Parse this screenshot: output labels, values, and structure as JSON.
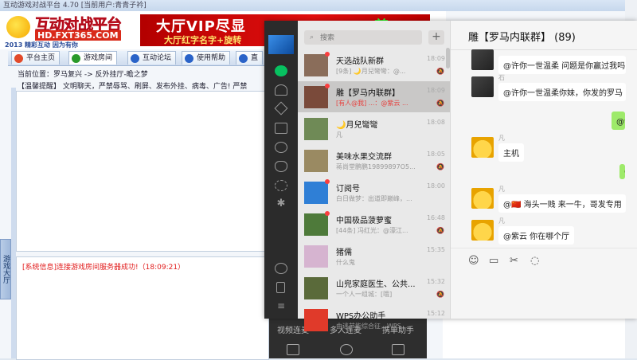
{
  "bg_app": {
    "title": "互动游戏对战平台 4.70 [当前用户:青青子衿]",
    "logo_title": "互动对战平台",
    "logo_url": "HD.FXT365.COM",
    "logo_slogan": "2013 精彩互动 因为有你",
    "ad_line1": "大厅VIP尽显",
    "ad_tail": "尊",
    "ad_line2": "大厅红字名字+旋转",
    "tabs": [
      {
        "label": "平台主页",
        "color": "#e24a2a"
      },
      {
        "label": "游戏房间",
        "color": "#2a9a2a"
      },
      {
        "label": "互动论坛",
        "color": "#2a63c8"
      },
      {
        "label": "使用帮助",
        "color": "#2a63c8"
      },
      {
        "label": "直",
        "color": "#2a63c8"
      }
    ],
    "breadcrumb": "当前位置：罗马复兴 -> 反外挂厅-瞻之梦",
    "notice": "【温馨提醒】 文明聊天，严禁辱骂、刷屏、发布外挂、病毒、广告! 严禁",
    "system_log": "[系统信息]连接游戏房间服务器成功!（18:09:21）",
    "side_tab": "游戏大厅",
    "below_labels": [
      "视频连麦",
      "多人连麦",
      "携单助手"
    ]
  },
  "wechat": {
    "search_placeholder": "搜索",
    "plus": "+",
    "conversations": [
      {
        "name": "天选战队新群",
        "preview": "[9条] 🌙月兒彎彎：@...",
        "time": "18:09",
        "muted": true,
        "dot": true,
        "selected": false,
        "avatar": "#8a6d5a"
      },
      {
        "name": "雕【罗马内联群】",
        "preview": "[有人@我] ...：@紫云 ...",
        "time": "18:09",
        "muted": true,
        "dot": true,
        "selected": true,
        "avatar": "#7a4a3a"
      },
      {
        "name": "🌙月兒彎彎",
        "preview": "凡",
        "time": "18:08",
        "muted": false,
        "dot": false,
        "selected": false,
        "avatar": "#6f8a56"
      },
      {
        "name": "美味水果交流群",
        "preview": "蒋尚堂鹏鹏19899897O5...",
        "time": "18:05",
        "muted": true,
        "dot": false,
        "selected": false,
        "avatar": "#9a8a62"
      },
      {
        "name": "订阅号",
        "preview": "白日做梦：出道即巅峰，...",
        "time": "18:00",
        "muted": false,
        "dot": true,
        "selected": false,
        "avatar": "#2f7fd6"
      },
      {
        "name": "中国极品菠萝蜜",
        "preview": "[44条] 冯红光：@濠江...",
        "time": "16:48",
        "muted": true,
        "dot": true,
        "selected": false,
        "avatar": "#4e7a3a"
      },
      {
        "name": "猪儒",
        "preview": "什么鬼",
        "time": "15:35",
        "muted": false,
        "dot": false,
        "selected": false,
        "avatar": "#d6b4d0"
      },
      {
        "name": "山兜家庭医生、公共...",
        "preview": "一个人一组城：[哦]",
        "time": "15:32",
        "muted": true,
        "dot": false,
        "selected": false,
        "avatar": "#5a6a3a"
      },
      {
        "name": "WPS办公助手",
        "preview": "由逃节能综合征，WPS ...",
        "time": "15:12",
        "muted": false,
        "dot": false,
        "selected": false,
        "avatar": "#e03a2a"
      }
    ],
    "chat_title": "雕【罗马内联群】 (89)",
    "messages": [
      {
        "side": "left",
        "name": "",
        "text": "@许你一世温柔 问题是你赢过我吗",
        "avatar": "dark"
      },
      {
        "side": "left",
        "name": "石",
        "text": "@许你一世温柔你妹，你发的罗马",
        "avatar": "dark"
      },
      {
        "side": "right",
        "name": "",
        "text": "@许",
        "avatar": ""
      },
      {
        "side": "left",
        "name": "凡",
        "text": "主机",
        "avatar": "emoji"
      },
      {
        "side": "right",
        "name": "",
        "text": "@",
        "avatar": ""
      },
      {
        "side": "left",
        "name": "凡",
        "text": "@🇨🇳 海头一贱 来一牛，哥发专用",
        "avatar": "emoji"
      },
      {
        "side": "left",
        "name": "凡",
        "text": "@紫云 你在哪个厅",
        "avatar": "emoji"
      }
    ]
  }
}
